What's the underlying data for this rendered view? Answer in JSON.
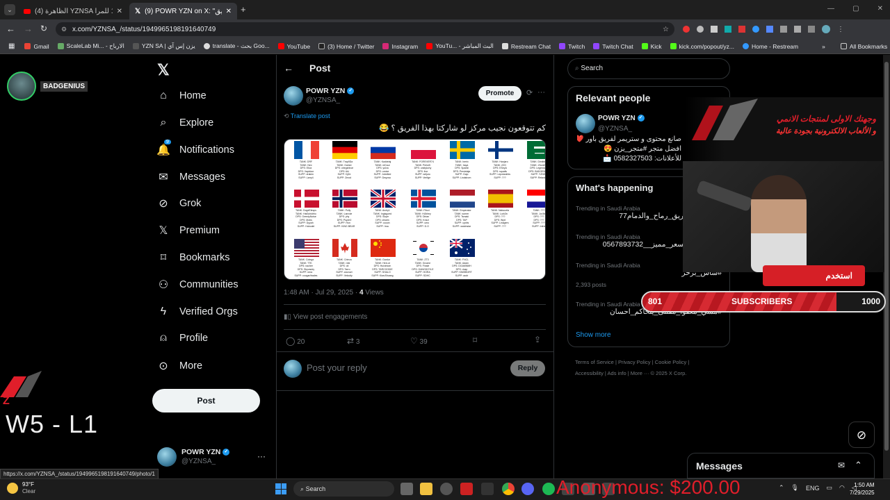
{
  "browser": {
    "tabs": [
      {
        "label": "(4) الظاهرة YZNSA والتوب1 للمرا"
      },
      {
        "label": "(9) POWR YZN on X: \"كم الفريق \""
      }
    ],
    "url": "x.com/YZNSA_/status/1949965198191640749",
    "bookmarks": [
      "Gmail",
      "ScaleLab Mi... - الارباح",
      "YZN SA | يزن إس آي",
      "translate - بحث Goo...",
      "YouTube",
      "(3) Home / Twitter",
      "Instagram",
      "YouTu... - البث المباشر",
      "Restream Chat",
      "Twitch",
      "Twitch Chat",
      "Kick",
      "kick.com/popout/yz...",
      "Home - Restream"
    ],
    "all_bookmarks": "All Bookmarks",
    "status_url": "https://x.com/YZNSA_/status/1949965198191640749/photo/1"
  },
  "overlay": {
    "user": "BADGENIUS",
    "score": "W5 - L1",
    "subs_current": "801",
    "subs_label": "SUBSCRIBERS",
    "subs_goal": "1000",
    "promo_text_1": "وجهتك الاولى لمنتجات الانمي",
    "promo_text_2": "و الألعاب الالكترونية بجودة عالية",
    "promo_label": "استخدم",
    "donation": "Anonymous: $200.00"
  },
  "nav": {
    "items": [
      {
        "label": "Home",
        "icon": "home-icon"
      },
      {
        "label": "Explore",
        "icon": "search-icon"
      },
      {
        "label": "Notifications",
        "icon": "bell-icon",
        "badge": "9"
      },
      {
        "label": "Messages",
        "icon": "mail-icon"
      },
      {
        "label": "Grok",
        "icon": "grok-icon"
      },
      {
        "label": "Premium",
        "icon": "x-icon"
      },
      {
        "label": "Bookmarks",
        "icon": "bookmark-icon"
      },
      {
        "label": "Communities",
        "icon": "people-icon"
      },
      {
        "label": "Verified Orgs",
        "icon": "lightning-icon"
      },
      {
        "label": "Profile",
        "icon": "person-icon"
      },
      {
        "label": "More",
        "icon": "more-icon"
      }
    ],
    "post_button": "Post",
    "account_name": "POWR YZN",
    "account_handle": "@YZNSA_"
  },
  "post": {
    "header": "Post",
    "author": "POWR YZN",
    "handle": "@YZNSA_",
    "promote": "Promote",
    "translate": "Translate post",
    "text": "كم تتوقعون نجيب مركز لو شاركتا بهذا الفريق ؟ 😂",
    "time": "1:48 AM · Jul 29, 2025 · ",
    "views_count": "4",
    "views_label": " Views",
    "engagements": "View post engagements",
    "replies": "20",
    "reposts": "3",
    "likes": "39",
    "reply_placeholder": "Post your reply",
    "reply_button": "Reply",
    "flags": [
      {
        "country": "France",
        "colors": [
          "#0055a4",
          "#fff",
          "#ef4135"
        ],
        "orient": "v",
        "lines": [
          "TANK: DRF",
          "TANK: Nex",
          "DPS: Eliux",
          "DPS: Vapidzor",
          "SUPP: drakim",
          "SUPP: Larry4"
        ]
      },
      {
        "country": "Germany",
        "colors": [
          "#000",
          "#dd0000",
          "#ffce00"
        ],
        "orient": "h",
        "lines": [
          "TANK: Trap9Da",
          "TANK: Gainer",
          "DPS: ohegshhoe",
          "DPS: tiki",
          "SUPP: DjZe",
          "SUPP: Zmod"
        ]
      },
      {
        "country": "Russia",
        "colors": [
          "#fff",
          "#0039a6",
          "#d52b1e"
        ],
        "orient": "h",
        "lines": [
          "TANK: Kaddelaj",
          "TANK: mDuur",
          "DPS: yulva",
          "DPS: ornice",
          "SUPP: Jubelted",
          "SUPP: Deqzsa"
        ]
      },
      {
        "country": "Poland",
        "colors": [
          "#fff",
          "#dc143c"
        ],
        "orient": "h",
        "lines": [
          "TANK: FOREVER74",
          "TANK: Perloi5",
          "DPS: unstykchy",
          "DPS: ihcr",
          "SUPP: seljuro",
          "SUPP: Verifge"
        ]
      },
      {
        "country": "Sweden",
        "colors": [
          "#006aa7",
          "#fecc00"
        ],
        "orient": "cross",
        "lines": [
          "TANK: Inerix",
          "TANK: haya",
          "DPS: Sparkli",
          "DPS: Persistaja",
          "SUPP: Gajo",
          "SUPP: Lindstrom"
        ]
      },
      {
        "country": "Finland",
        "colors": [
          "#fff",
          "#003580"
        ],
        "orient": "cross",
        "lines": [
          "TANK: Hanjaro",
          "TANK: ZZG",
          "DPS: ESeyA",
          "DPS: squalls",
          "SUPP: Lepolaskhis",
          "SUPP: ???"
        ]
      },
      {
        "country": "Saudi Arabia",
        "colors": [
          "#006c35",
          "#fff"
        ],
        "orient": "sa",
        "lines": [
          "TANK: Dimibber",
          "TANK: Zhonthio",
          "DPS: Legendary",
          "DPS: BADGENIUS",
          "SUPP: YZNSA",
          "SUPP: Relaxing"
        ]
      },
      {
        "country": "Denmark",
        "colors": [
          "#c8102e",
          "#fff"
        ],
        "orient": "cross",
        "lines": [
          "TANK: DogeElesps",
          "TANK: Hat3chidrho",
          "DPS: GreedyNoise",
          "DPS: Mobs",
          "SUPP: Dyyah",
          "SUPP: Hobodel"
        ]
      },
      {
        "country": "Norway",
        "colors": [
          "#ba0c2f",
          "#fff",
          "#00205b"
        ],
        "orient": "cross2",
        "lines": [
          "TANK: Polly",
          "TANK: Lanrole",
          "DPS: yhy",
          "DPS: Psych0",
          "SUPP: Hon",
          "SUPP: KING BEAR"
        ]
      },
      {
        "country": "United Kingdom",
        "colors": [
          "#012169",
          "#fff",
          "#c8102e"
        ],
        "orient": "uk",
        "lines": [
          "TANK: Archy1",
          "TANK: Ingisgoed",
          "DPS: Slope",
          "DPS: chiaim",
          "SUPP: ooooh",
          "SUPP: Ima"
        ]
      },
      {
        "country": "Iceland",
        "colors": [
          "#02529c",
          "#fff",
          "#dc1e35"
        ],
        "orient": "cross2",
        "lines": [
          "TANK: Flinzi",
          "TANK: HiJkhey",
          "DPS: Dirian",
          "DPS: Krizzi",
          "SUPP: umo",
          "SUPP: D.O"
        ]
      },
      {
        "country": "Netherlands",
        "colors": [
          "#ae1c28",
          "#fff",
          "#21468b"
        ],
        "orient": "h",
        "lines": [
          "TANK: Emperator",
          "TANK: somer",
          "DPS: Tsmaki",
          "DPS: TAP",
          "SUPP: cydris",
          "SUPP: watchstar"
        ]
      },
      {
        "country": "Spain",
        "colors": [
          "#aa151b",
          "#f1bf00",
          "#aa151b"
        ],
        "orient": "es",
        "lines": [
          "TANK: Nabuuela",
          "TANK: Lurk3n",
          "DPS: ???",
          "DPS: Wyrt",
          "SUPP: Linagers",
          "SUPP: ???"
        ]
      },
      {
        "country": "Croatia",
        "colors": [
          "#ff0000",
          "#fff",
          "#171796"
        ],
        "orient": "h",
        "lines": [
          "TANK: ???",
          "TANK: Jur3by",
          "DPS: ???",
          "DPS: ???",
          "SUPP: ???",
          "SUPP: Infrer"
        ]
      },
      {
        "country": "United States",
        "colors": [
          "#b22234",
          "#fff",
          "#3c3b6e"
        ],
        "orient": "us",
        "lines": [
          "TANK: Colega",
          "TANK: TTK",
          "DPS: nacher",
          "DPS: Skyvaulry",
          "SUPP: nera",
          "SUPP: cougar/trades"
        ]
      },
      {
        "country": "Canada",
        "colors": [
          "#d52b1e",
          "#fff"
        ],
        "orient": "ca",
        "lines": [
          "TANK: Crimzo",
          "TANK: reki",
          "DPS: cit",
          "DPS: Tarro",
          "SUPP: anonort",
          "SUPP: Velocity"
        ]
      },
      {
        "country": "China",
        "colors": [
          "#de2910",
          "#ffde00"
        ],
        "orient": "cn",
        "lines": [
          "TANK: Gardur",
          "TANK: HerLot",
          "DPS: Huixintom",
          "DPS: TARCOOKIE",
          "SUPP: SHALO",
          "SUPP: KiwuShuang"
        ]
      },
      {
        "country": "South Korea",
        "colors": [
          "#fff",
          "#cd2e3a",
          "#0047a0"
        ],
        "orient": "kr",
        "lines": [
          "TANK: ZT3",
          "TANK: Gnome",
          "DPS: Finale",
          "DPS: GANGDOYLE",
          "SUPP: HORA",
          "SUPP: SDHC"
        ]
      },
      {
        "country": "Australia",
        "colors": [
          "#012169",
          "#fff",
          "#e4002b"
        ],
        "orient": "au",
        "lines": [
          "TANK: FNCL",
          "TANK: Adam",
          "DPS: DGAMNMH",
          "DPS: dusp",
          "SUPP: KIMSBORT",
          "SUPP: aodr"
        ]
      }
    ]
  },
  "sidebar": {
    "search_placeholder": "Search",
    "relevant_title": "Relevant people",
    "relevant_name": "POWR YZN",
    "relevant_handle": "@YZNSA_",
    "relevant_bio": [
      "صانع محتوى و ستريمر لفريق باور ❤️",
      "افضل متجر #متجر_يزن 😍",
      "للأعلانات: 0582327503 📩"
    ],
    "happening_title": "What's happening",
    "trends": [
      {
        "context": "Trending in Saudi Arabia",
        "name": "ريق_رماح_والدمام77"
      },
      {
        "context": "Trending in Saudi Arabia",
        "name": "سعر_مميز__0567893732"
      },
      {
        "context": "Trending in Saudi Arabia",
        "name": "#ساس_برحر",
        "count": "2,393 posts"
      },
      {
        "context": "Trending in Saudi Arabia",
        "name": "#مشي_معفوا_مقتنى_يتحاكم_احسان"
      }
    ],
    "show_more": "Show more",
    "footer": [
      "Terms of Service",
      "Privacy Policy",
      "Cookie Policy",
      "Accessibility",
      "Ads info",
      "More ···",
      "© 2025 X Corp."
    ],
    "messages": "Messages"
  },
  "taskbar": {
    "temp": "93°F",
    "weather": "Clear",
    "search": "Search",
    "lang": "ENG",
    "time": "1:50 AM",
    "date": "7/29/2025"
  }
}
